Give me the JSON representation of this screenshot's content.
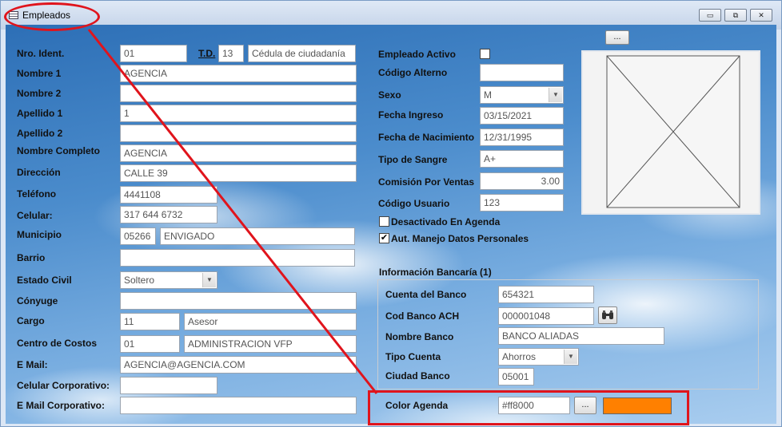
{
  "window": {
    "title": "Empleados",
    "controls": {
      "minimize": "▭",
      "restore": "⧉",
      "close": "✕"
    }
  },
  "left": {
    "nro_ident": {
      "label": "Nro. Ident.",
      "value": "01"
    },
    "td": {
      "label": "T.D.",
      "code": "13",
      "description": "Cédula de ciudadanía"
    },
    "nombre1": {
      "label": "Nombre 1",
      "value": "AGENCIA"
    },
    "nombre2": {
      "label": "Nombre 2",
      "value": ""
    },
    "apellido1": {
      "label": "Apellido 1",
      "value": "1"
    },
    "apellido2": {
      "label": "Apellido 2",
      "value": ""
    },
    "nombre_completo": {
      "label": "Nombre Completo",
      "value": "AGENCIA"
    },
    "direccion": {
      "label": "Dirección",
      "value": "CALLE 39"
    },
    "telefono": {
      "label": "Teléfono",
      "value": "4441108"
    },
    "celular": {
      "label": "Celular:",
      "value": "317 644 6732"
    },
    "municipio": {
      "label": "Municipio",
      "code": "05266",
      "name": "ENVIGADO"
    },
    "barrio": {
      "label": "Barrio",
      "value": ""
    },
    "estado_civil": {
      "label": "Estado Civil",
      "value": "Soltero"
    },
    "conyuge": {
      "label": "Cónyuge",
      "value": ""
    },
    "cargo": {
      "label": "Cargo",
      "code": "11",
      "name": "Asesor"
    },
    "centro_costos": {
      "label": "Centro de Costos",
      "code": "01",
      "name": "ADMINISTRACION VFP"
    },
    "email": {
      "label": "E Mail:",
      "value": "AGENCIA@AGENCIA.COM"
    },
    "celular_corp": {
      "label": "Celular Corporativo:",
      "value": ""
    },
    "email_corp": {
      "label": "E Mail Corporativo:",
      "value": ""
    }
  },
  "right": {
    "empleado_activo": {
      "label": "Empleado Activo",
      "checked": false
    },
    "codigo_alterno": {
      "label": "Código Alterno",
      "value": ""
    },
    "sexo": {
      "label": "Sexo",
      "value": "M"
    },
    "fecha_ingreso": {
      "label": "Fecha Ingreso",
      "value": "03/15/2021"
    },
    "fecha_nacimiento": {
      "label": "Fecha de Nacimiento",
      "value": "12/31/1995"
    },
    "tipo_sangre": {
      "label": "Tipo de Sangre",
      "value": "A+"
    },
    "comision": {
      "label": "Comisión Por Ventas",
      "value": "3.00"
    },
    "codigo_usuario": {
      "label": "Código Usuario",
      "value": "123"
    },
    "desactivado_agenda": {
      "label": "Desactivado En Agenda",
      "checked": false,
      "mark": ""
    },
    "aut_manejo": {
      "label": "Aut. Manejo Datos Personales",
      "checked": true,
      "mark": "✔"
    },
    "photo_button": "..."
  },
  "bank": {
    "title": "Información Bancaría (1)",
    "cuenta": {
      "label": "Cuenta del Banco",
      "value": "654321"
    },
    "cod_ach": {
      "label": "Cod Banco ACH",
      "value": "000001048",
      "button_icon": "binoculars-icon"
    },
    "nombre_banco": {
      "label": "Nombre Banco",
      "value": "BANCO ALIADAS"
    },
    "tipo_cuenta": {
      "label": "Tipo Cuenta",
      "value": "Ahorros"
    },
    "ciudad": {
      "label": "Ciudad Banco",
      "value": "05001"
    }
  },
  "agenda": {
    "label": "Color Agenda",
    "value": "#ff8000",
    "button": "...",
    "swatch_color": "#ff8000"
  },
  "annotation_color": "#e0141c"
}
